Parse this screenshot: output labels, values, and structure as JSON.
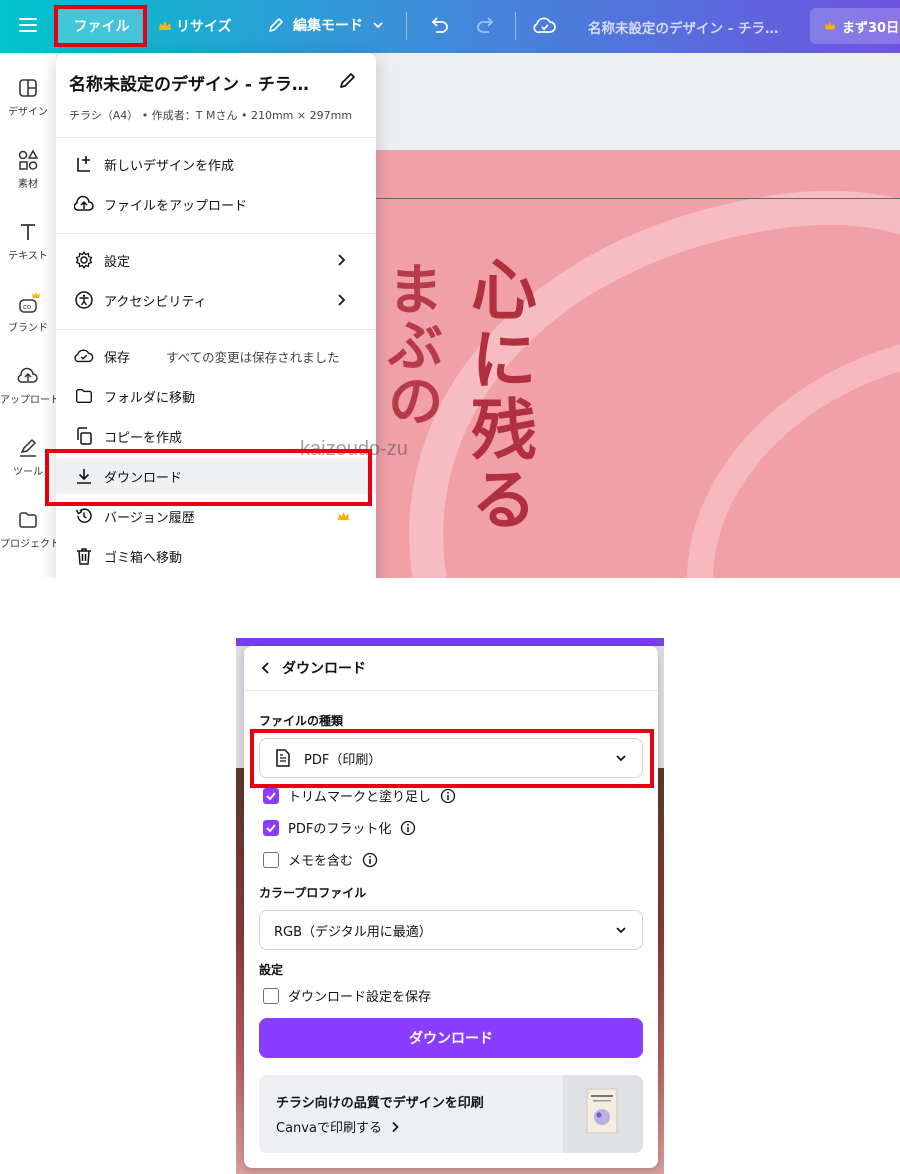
{
  "topbar": {
    "file_label": "ファイル",
    "resize_label": "リサイズ",
    "edit_mode_label": "編集モード",
    "doc_title": "名称未設定のデザイン - チラ…",
    "trial_label": "まず30日"
  },
  "sidebar": {
    "items": [
      {
        "label": "デザイン"
      },
      {
        "label": "素材"
      },
      {
        "label": "テキスト"
      },
      {
        "label": "ブランド"
      },
      {
        "label": "アップロード"
      },
      {
        "label": "ツール"
      },
      {
        "label": "プロジェクト"
      }
    ]
  },
  "canvas": {
    "big_text": "心に残る",
    "side_text": "まぶの",
    "watermark": "kaizoudo-zu"
  },
  "file_menu": {
    "title": "名称未設定のデザイン - チラ…",
    "meta": "チラシ（A4） • 作成者：T Mさん • 210mm × 297mm",
    "new_design": "新しいデザインを作成",
    "upload": "ファイルをアップロード",
    "settings": "設定",
    "accessibility": "アクセシビリティ",
    "save": "保存",
    "save_status": "すべての変更は保存されました",
    "move_folder": "フォルダに移動",
    "make_copy": "コピーを作成",
    "download": "ダウンロード",
    "version_history": "バージョン履歴",
    "trash": "ゴミ箱へ移動"
  },
  "download_panel": {
    "title": "ダウンロード",
    "file_type_label": "ファイルの種類",
    "file_type_value": "PDF（印刷）",
    "options": [
      {
        "label": "トリムマークと塗り足し",
        "checked": true
      },
      {
        "label": "PDFのフラット化",
        "checked": true
      },
      {
        "label": "メモを含む",
        "checked": false
      }
    ],
    "color_profile_label": "カラープロファイル",
    "color_profile_value": "RGB（デジタル用に最適）",
    "settings_label": "設定",
    "save_settings_label": "ダウンロード設定を保存",
    "save_settings_checked": false,
    "download_button": "ダウンロード",
    "promo_title": "チラシ向けの品質でデザインを印刷",
    "promo_link": "Canvaで印刷する"
  },
  "colors": {
    "accent": "#8b3dff",
    "highlight_box": "#e60012",
    "design_bg": "#f1a0a8",
    "design_text": "#b0303f"
  }
}
